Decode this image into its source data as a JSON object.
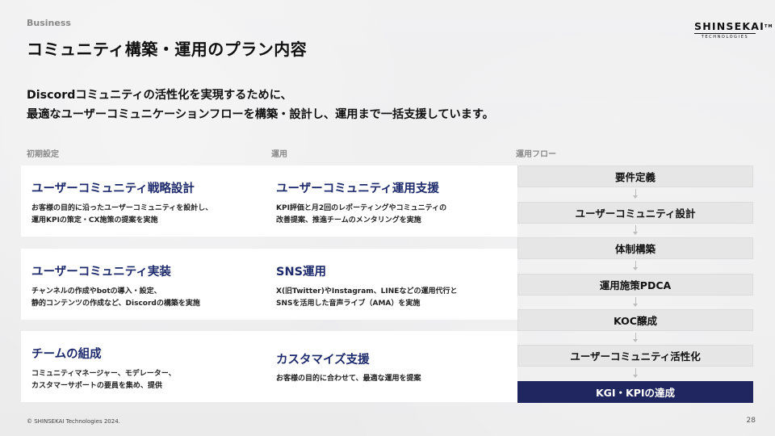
{
  "header": {
    "category": "Business",
    "title": "コミュニティ構築・運用のプラン内容",
    "logo": {
      "main": "SHINSEKAI",
      "tm": "TM",
      "sub": "TECHNOLOGIES"
    }
  },
  "lead": {
    "line1": "Discordコミュニティの活性化を実現するために、",
    "line2": "最適なユーザーコミュニケーションフローを構築・設計し、運用まで一括支援しています。"
  },
  "columns": {
    "initial": {
      "label": "初期設定",
      "cards": [
        {
          "title": "ユーザーコミュニティ戦略設計",
          "desc": "お客様の目的に沿ったユーザーコミュニティを設計し、\n運用KPIの策定・CX施策の提案を実施"
        },
        {
          "title": "ユーザーコミュニティ実装",
          "desc": "チャンネルの作成やbotの導入・設定、\n静的コンテンツの作成など、Discordの構築を実施"
        },
        {
          "title": "チームの組成",
          "desc": "コミュニティマネージャー、モデレーター、\nカスタマーサポートの要員を集め、提供"
        }
      ]
    },
    "operation": {
      "label": "運用",
      "cards": [
        {
          "title": "ユーザーコミュニティ運用支援",
          "desc": "KPI評価と月2回のレポーティングやコミュニティの\n改善提案、推進チームのメンタリングを実施"
        },
        {
          "title": "SNS運用",
          "desc": "X(旧Twitter)やInstagram、LINEなどの運用代行と\nSNSを活用した音声ライブ（AMA）を実施"
        },
        {
          "title": "カスタマイズ支援",
          "desc": "お客様の目的に合わせて、最適な運用を提案"
        }
      ]
    },
    "flow": {
      "label": "運用フロー",
      "steps": [
        "要件定義",
        "ユーザーコミュニティ設計",
        "体制構築",
        "運用施策PDCA",
        "KOC醸成",
        "ユーザーコミュニティ活性化",
        "KGI・KPIの達成"
      ]
    }
  },
  "footer": {
    "copyright": "© SHINSEKAI Technologies 2024.",
    "page_number": "28"
  },
  "colors": {
    "accent_navy": "#1d2a6b",
    "final_step_bg": "#202660",
    "background": "#eeeeef"
  }
}
